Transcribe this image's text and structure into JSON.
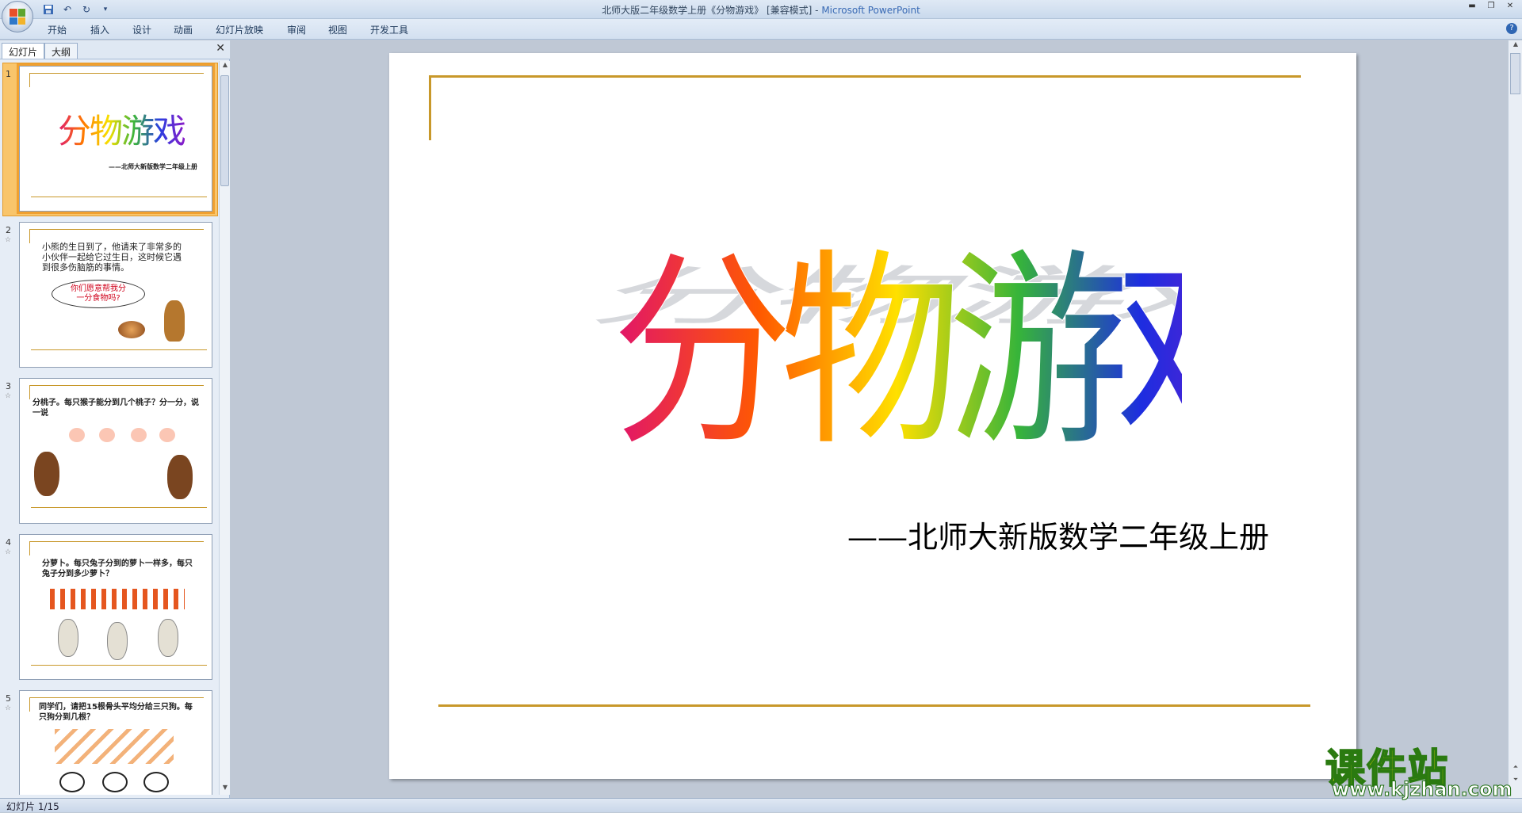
{
  "window": {
    "title_doc": "北师大版二年级数学上册《分物游戏》 [兼容模式] - ",
    "title_app": "Microsoft PowerPoint"
  },
  "ribbon": {
    "tabs": [
      "开始",
      "插入",
      "设计",
      "动画",
      "幻灯片放映",
      "审阅",
      "视图",
      "开发工具"
    ]
  },
  "panel": {
    "tabs": [
      "幻灯片",
      "大纲"
    ],
    "slides": [
      {
        "num": "1",
        "title": "分物游戏",
        "subtitle": "——北师大新版数学二年级上册"
      },
      {
        "num": "2",
        "text": "小熊的生日到了，他请来了非常多的小伙伴一起给它过生日，这时候它遇到很多伤脑筋的事情。",
        "bubble": "你们愿意帮我分一分食物吗?"
      },
      {
        "num": "3",
        "text": "分桃子。每只猴子能分到几个桃子？分一分，说一说"
      },
      {
        "num": "4",
        "text": "分萝卜。每只兔子分到的萝卜一样多，每只兔子分到多少萝卜？"
      },
      {
        "num": "5",
        "text": "同学们，请把15根骨头平均分给三只狗。每只狗分到几根？"
      }
    ]
  },
  "slide": {
    "title": "分物游戏",
    "subtitle": "——北师大新版数学二年级上册"
  },
  "status": {
    "text": "幻灯片 1/15"
  },
  "watermark": {
    "main": "课件站",
    "url": "www.kjzhan.com"
  },
  "colors": {
    "accent_line": "#c8982a",
    "selection": "#f9c56b"
  }
}
